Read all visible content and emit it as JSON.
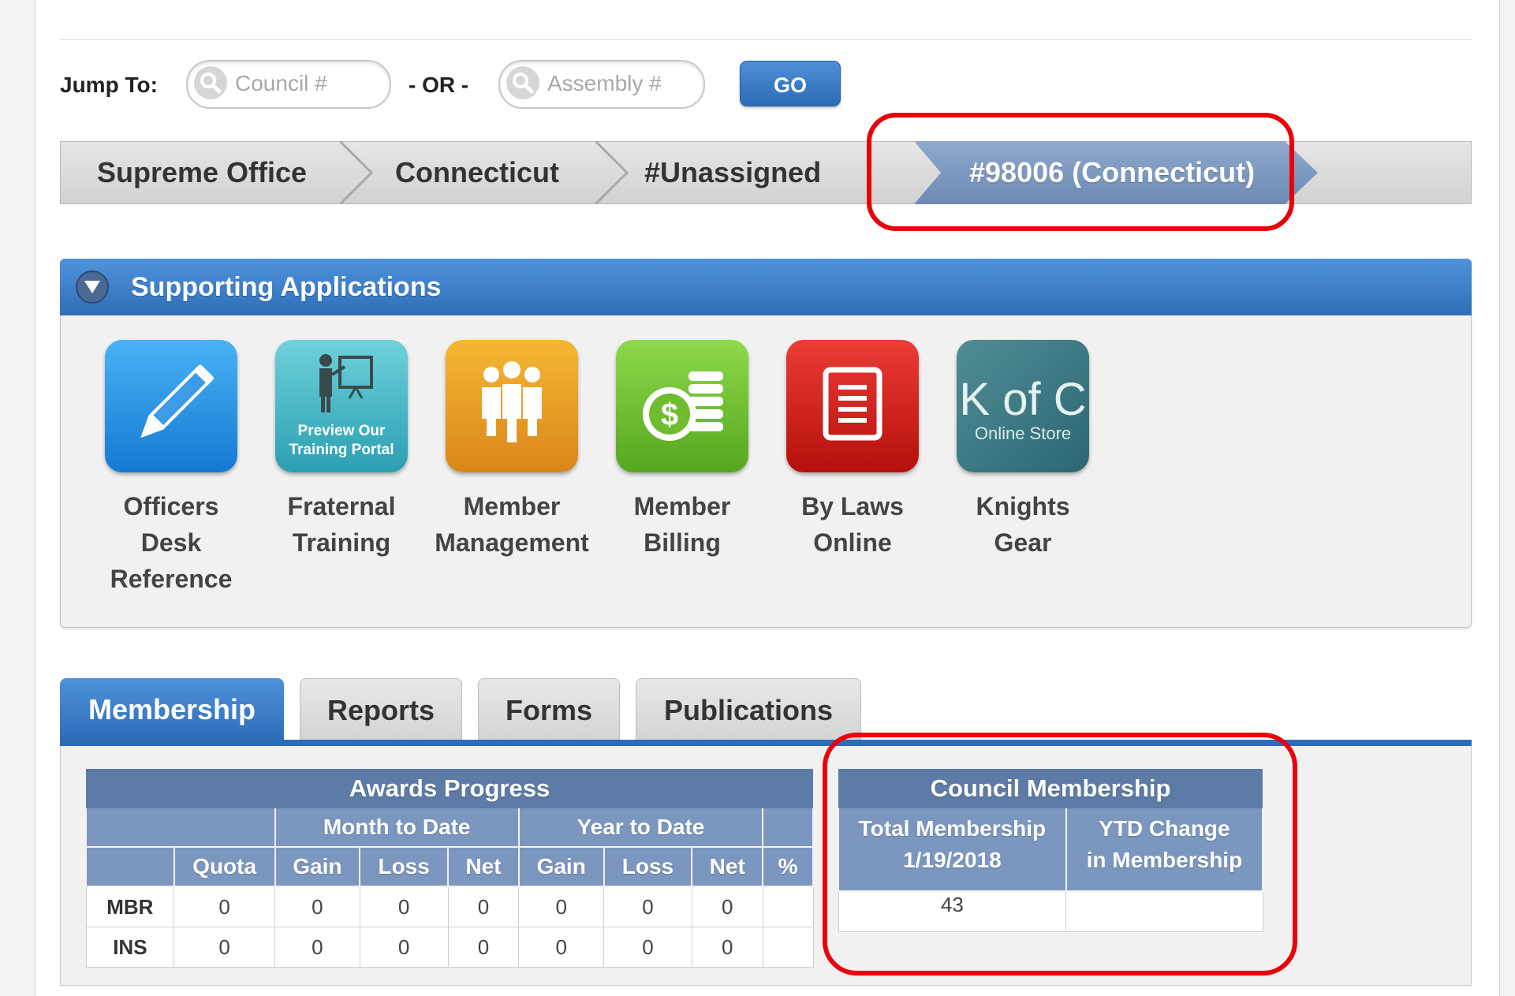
{
  "jump_bar": {
    "label": "Jump To:",
    "council_placeholder": "Council #",
    "or_label": "- OR -",
    "assembly_placeholder": "Assembly #",
    "go_label": "GO"
  },
  "breadcrumb": {
    "items": [
      "Supreme Office",
      "Connecticut",
      "#Unassigned",
      "#98006 (Connecticut)"
    ],
    "active_color": "#7b97bf"
  },
  "supporting_apps": {
    "title": "Supporting Applications",
    "apps": [
      {
        "lines": [
          "Officers",
          "Desk",
          "Reference"
        ],
        "icon": "pencil-icon",
        "color": "#1f8be0"
      },
      {
        "lines": [
          "Fraternal",
          "Training"
        ],
        "icon": "presenter-icon",
        "tile_text": [
          "Preview Our",
          "Training Portal"
        ],
        "color": "#3fb4c4"
      },
      {
        "lines": [
          "Member",
          "Management"
        ],
        "icon": "group-icon",
        "color": "#e89b22"
      },
      {
        "lines": [
          "Member",
          "Billing"
        ],
        "icon": "coins-dollar-icon",
        "color": "#6fbd2f"
      },
      {
        "lines": [
          "By Laws",
          "Online"
        ],
        "icon": "document-icon",
        "color": "#d1201b"
      },
      {
        "lines": [
          "Knights",
          "Gear"
        ],
        "icon": "kofc-store-logo",
        "tile_text": [
          "K of C",
          "Online Store"
        ],
        "color": "#3d7c85"
      }
    ]
  },
  "tabs": [
    {
      "label": "Membership",
      "active": true
    },
    {
      "label": "Reports",
      "active": false
    },
    {
      "label": "Forms",
      "active": false
    },
    {
      "label": "Publications",
      "active": false
    }
  ],
  "awards_progress": {
    "title": "Awards Progress",
    "groups": [
      "Month to Date",
      "Year to Date"
    ],
    "columns": [
      "Quota",
      "Gain",
      "Loss",
      "Net",
      "Gain",
      "Loss",
      "Net",
      "%"
    ],
    "rows": [
      {
        "label": "MBR",
        "values": [
          "0",
          "0",
          "0",
          "0",
          "0",
          "0",
          "0",
          ""
        ]
      },
      {
        "label": "INS",
        "values": [
          "0",
          "0",
          "0",
          "0",
          "0",
          "0",
          "0",
          ""
        ]
      }
    ]
  },
  "council_membership": {
    "title": "Council Membership",
    "col1": [
      "Total Membership",
      "1/19/2018"
    ],
    "col2": [
      "YTD Change",
      "in Membership"
    ],
    "values": [
      "43",
      ""
    ]
  },
  "highlight_color": "#e8000b"
}
